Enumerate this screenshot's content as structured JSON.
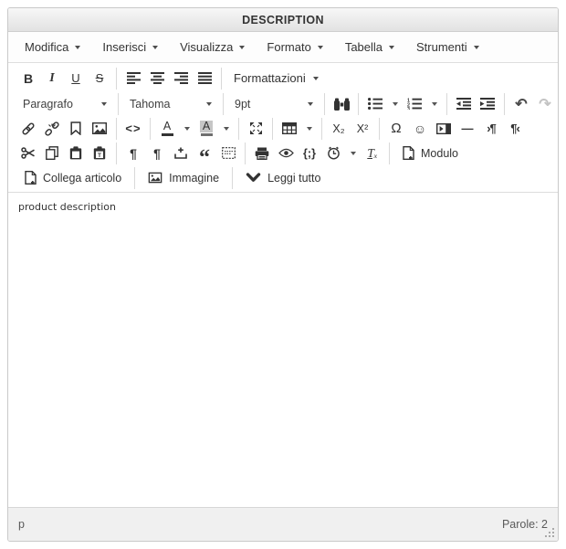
{
  "colors": {
    "panel_border": "#c9c9c9",
    "header_bg_top": "#f7f7f7",
    "header_bg_bottom": "#e2e2e2",
    "icon": "#333333",
    "disabled_icon": "#c3c3c3",
    "statusbar_bg": "#f0f0f0",
    "forecolor_bar": "#333333",
    "backcolor_swatch": "#c6c6c6"
  },
  "header": {
    "title": "DESCRIPTION"
  },
  "menubar": {
    "items": [
      "Modifica",
      "Inserisci",
      "Visualizza",
      "Formato",
      "Tabella",
      "Strumenti"
    ]
  },
  "toolbar": {
    "formats": "Formattazioni",
    "block_style": "Paragrafo",
    "font_name": "Tahoma",
    "font_size": "9pt",
    "modulo": "Modulo",
    "collega_articolo": "Collega articolo",
    "immagine": "Immagine",
    "leggi_tutto": "Leggi tutto"
  },
  "icons": {
    "bold": "B",
    "italic": "I",
    "underline": "U",
    "strikethrough": "S",
    "code": "<>",
    "forecolor": "A",
    "backcolor": "A",
    "subscript": "X₂",
    "superscript": "X²",
    "special_char": "Ω",
    "emoticon": "☺",
    "horizontal_rule": "—",
    "ltr": "›¶",
    "rtl": "¶‹",
    "visual_chars": "¶",
    "nonbreaking": "¶",
    "blockquote": "“",
    "code_sample": "{;}",
    "clear_formatting": "Tₓ",
    "undo": "↶",
    "redo": "↷"
  },
  "content": {
    "text": "product description"
  },
  "statusbar": {
    "element_path": "p",
    "word_count": "Parole: 2"
  }
}
